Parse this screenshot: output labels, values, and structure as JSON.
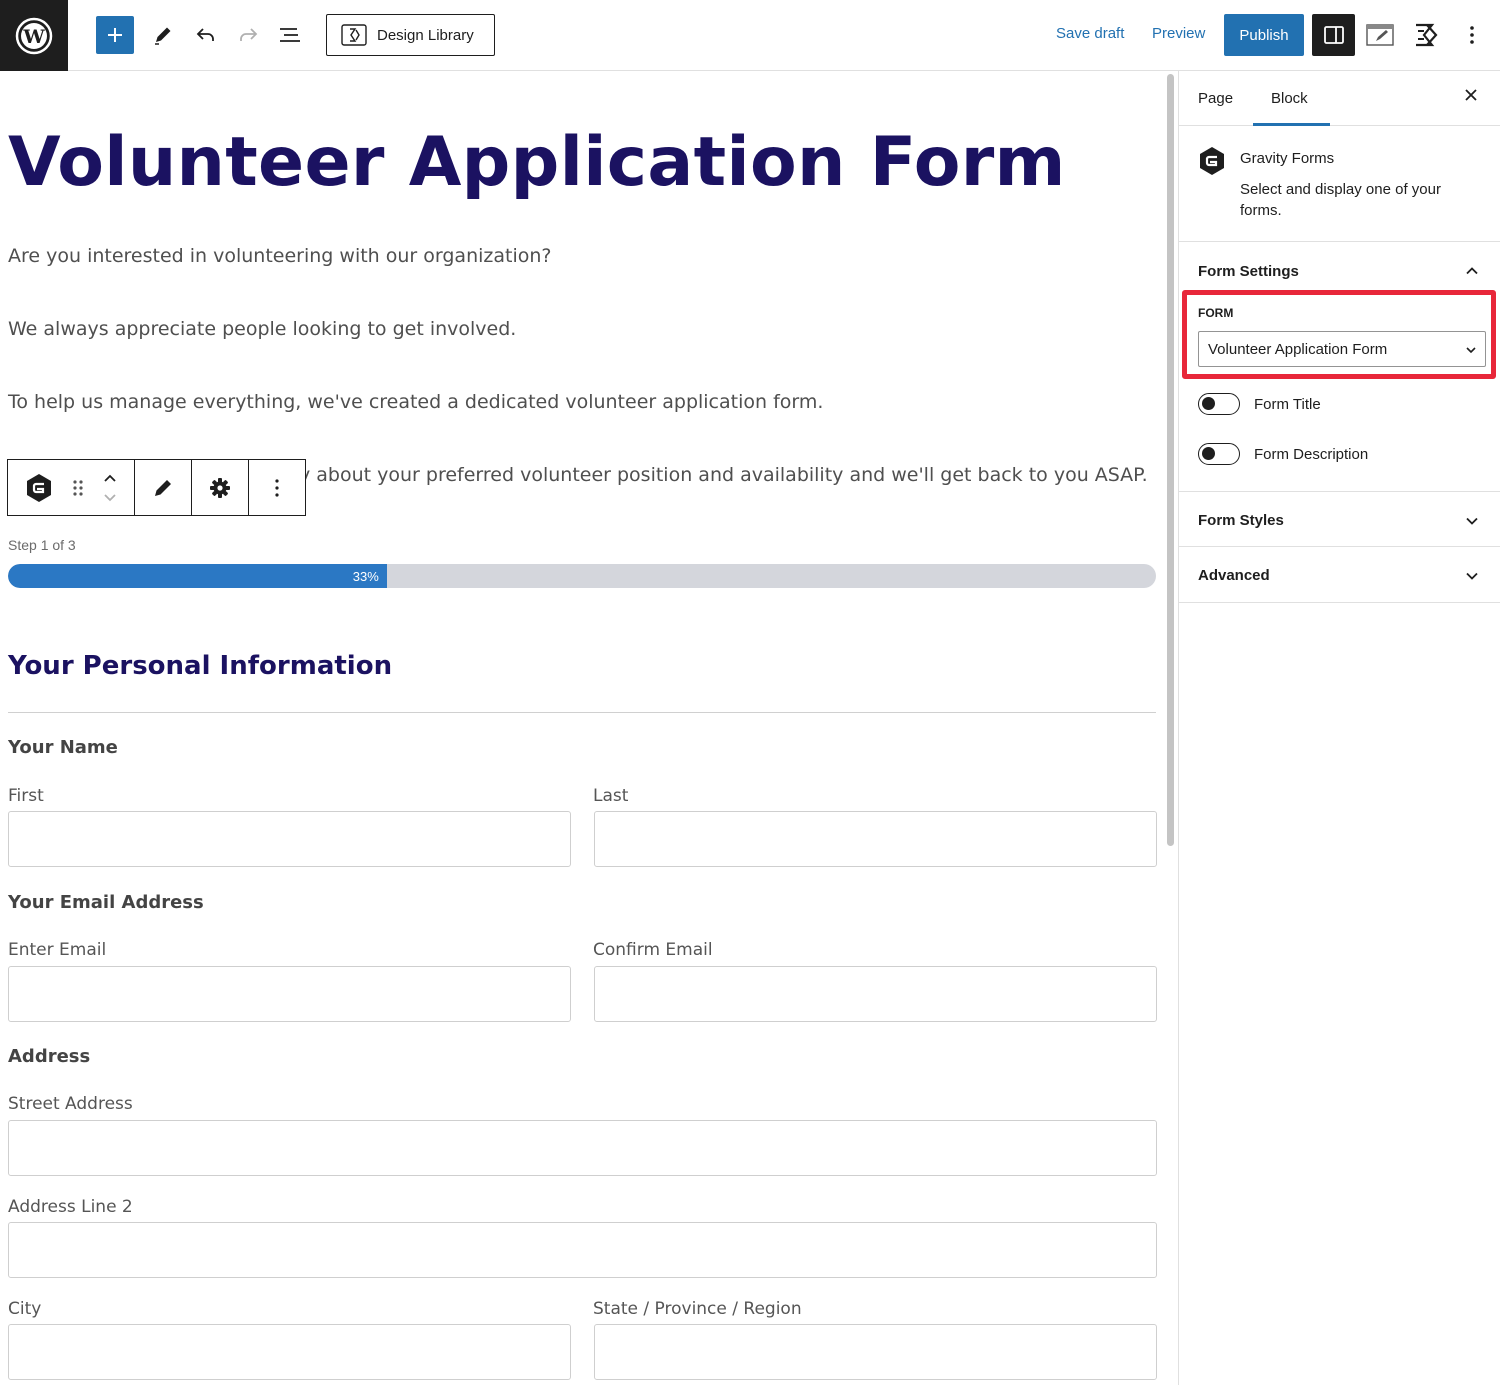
{
  "topbar": {
    "design_library_label": "Design Library",
    "save_draft_label": "Save draft",
    "preview_label": "Preview",
    "publish_label": "Publish"
  },
  "page": {
    "title": "Volunteer Application Form",
    "paragraphs": [
      "Are you interested in volunteering with our organization?",
      "We always appreciate people looking to get involved.",
      "To help us manage everything, we've created a dedicated volunteer application form.",
      "y about your preferred volunteer position and availability and we'll get back to you ASAP."
    ]
  },
  "form": {
    "step_label": "Step 1 of 3",
    "progress_percent": 33,
    "progress_label": "33%",
    "section_title": "Your Personal Information",
    "name_group": "Your Name",
    "first_label": "First",
    "last_label": "Last",
    "email_group": "Your Email Address",
    "enter_email_label": "Enter Email",
    "confirm_email_label": "Confirm Email",
    "address_group": "Address",
    "street_label": "Street Address",
    "line2_label": "Address Line 2",
    "city_label": "City",
    "state_label": "State / Province / Region"
  },
  "sidebar": {
    "tabs": [
      "Page",
      "Block"
    ],
    "active_tab": "Block",
    "block_name": "Gravity Forms",
    "block_description": "Select and display one of your forms.",
    "form_settings_title": "Form Settings",
    "form_label": "FORM",
    "form_selected": "Volunteer Application Form",
    "toggle_title_label": "Form Title",
    "toggle_title_on": false,
    "toggle_description_label": "Form Description",
    "toggle_description_on": false,
    "form_styles_title": "Form Styles",
    "advanced_title": "Advanced"
  },
  "colors": {
    "accent": "#2271b1",
    "title_navy": "#1b1261",
    "progress_fill": "#2b78c4",
    "highlight": "#e8273a"
  }
}
